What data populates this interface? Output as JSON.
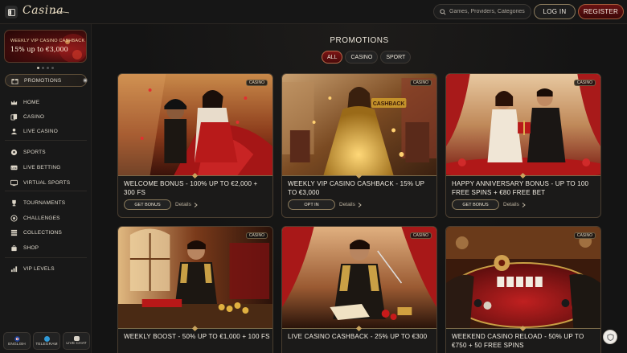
{
  "header": {
    "logo_text": "Casina",
    "search_placeholder": "Games, Providers, Categories",
    "login_label": "LOG IN",
    "register_label": "REGISTER"
  },
  "sidebar": {
    "banner": {
      "subtitle": "WEEKLY VIP CASINO CASHBACK",
      "headline": "15% up to €3,000"
    },
    "items": [
      {
        "label": "PROMOTIONS",
        "icon": "gift-icon",
        "active": true
      },
      {
        "label": "HOME",
        "icon": "crown-icon"
      },
      {
        "label": "CASINO",
        "icon": "cards-icon"
      },
      {
        "label": "LIVE CASINO",
        "icon": "dealer-icon"
      },
      {
        "label": "SPORTS",
        "icon": "soccer-ball-icon"
      },
      {
        "label": "LIVE BETTING",
        "icon": "live-tv-icon"
      },
      {
        "label": "VIRTUAL SPORTS",
        "icon": "virtual-screen-icon"
      },
      {
        "label": "TOURNAMENTS",
        "icon": "trophy-icon"
      },
      {
        "label": "CHALLENGES",
        "icon": "target-icon"
      },
      {
        "label": "COLLECTIONS",
        "icon": "stack-icon"
      },
      {
        "label": "SHOP",
        "icon": "shop-bag-icon"
      },
      {
        "label": "VIP LEVELS",
        "icon": "vip-ladder-icon"
      }
    ],
    "bottom": {
      "language": "ENGLISH",
      "telegram": "TELEGRAM",
      "live_chat": "LIVE CHAT"
    }
  },
  "main": {
    "title": "PROMOTIONS",
    "filters": [
      "ALL",
      "CASINO",
      "SPORT"
    ],
    "cards": [
      {
        "tag": "CASINO",
        "title": "WELCOME BONUS - 100% UP TO €2,000 + 300 FS",
        "cta": "GET BONUS",
        "details": "Details"
      },
      {
        "tag": "CASINO",
        "title": "WEEKLY VIP CASINO CASHBACK - 15% UP TO €3,000",
        "cta": "OPT IN",
        "details": "Details"
      },
      {
        "tag": "CASINO",
        "title": "HAPPY ANNIVERSARY BONUS - UP TO 100 FREE SPINS + €80 FREE BET",
        "cta": "GET BONUS",
        "details": "Details"
      },
      {
        "tag": "CASINO",
        "title": "WEEKLY BOOST - 50% UP TO €1,000 + 100 FS"
      },
      {
        "tag": "CASINO",
        "title": "LIVE CASINO CASHBACK - 25% UP TO €300"
      },
      {
        "tag": "CASINO",
        "title": "WEEKEND CASINO RELOAD - 50% UP TO €750 + 50 FREE SPINS"
      }
    ],
    "image_captions": {
      "card0": "CASHBACK"
    }
  },
  "colors": {
    "accent_red": "#6a1212",
    "gold_border": "#8a7a5c",
    "background": "#121212"
  }
}
